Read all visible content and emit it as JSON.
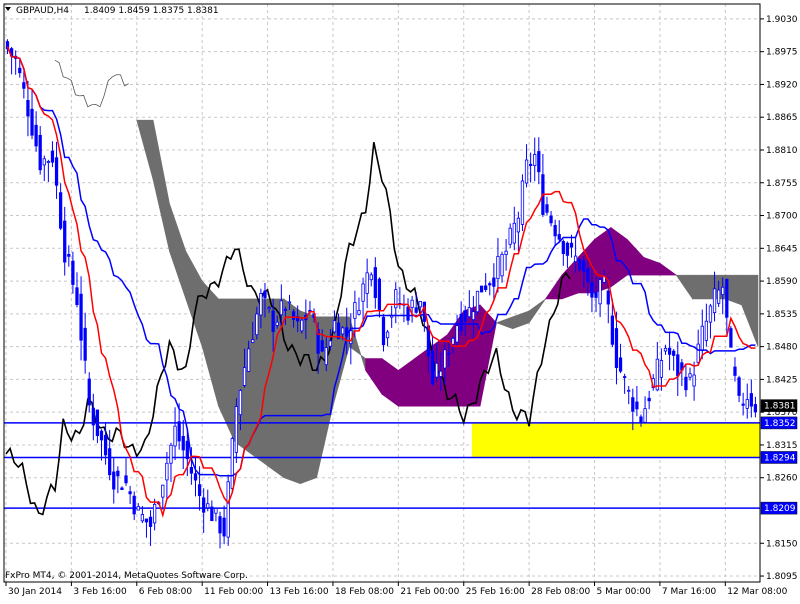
{
  "header": {
    "symbol_period": "GBPAUD,H4",
    "ohlc": "1.8409 1.8459 1.8375 1.8381"
  },
  "footer": {
    "copyright": "FxPro MT4, © 2001-2014, MetaQuotes Software Corp."
  },
  "colors": {
    "background": "#ffffff",
    "grid": "#c8c8c8",
    "candle": "#0000ff",
    "tenkan": "#ff0000",
    "kijun": "#0000ff",
    "chikou": "#000000",
    "cloud_up": "#6e6e6e",
    "cloud_down": "#800080",
    "zone": "#ffff00",
    "level": "#0000ff",
    "current_price_tag": "#000000"
  },
  "chart_data": {
    "type": "candlestick",
    "instrument": "GBPAUD",
    "timeframe": "H4",
    "ylim": [
      1.8085,
      1.9055
    ],
    "grid": true,
    "y_ticks": [
      "1.9030",
      "1.8975",
      "1.8920",
      "1.8865",
      "1.8810",
      "1.8755",
      "1.8700",
      "1.8645",
      "1.8590",
      "1.8535",
      "1.8480",
      "1.8425",
      "1.8370",
      "1.8315",
      "1.8260",
      "1.8150",
      "1.8095"
    ],
    "x_ticks": [
      "30 Jan 2014",
      "3 Feb 16:00",
      "6 Feb 08:00",
      "11 Feb 00:00",
      "13 Feb 16:00",
      "18 Feb 08:00",
      "21 Feb 00:00",
      "25 Feb 16:00",
      "28 Feb 08:00",
      "5 Mar 00:00",
      "7 Mar 16:00",
      "12 Mar 08:00"
    ],
    "x_tick_index": [
      0,
      16,
      32,
      48,
      64,
      80,
      96,
      112,
      128,
      144,
      160,
      176
    ],
    "bar_count": 184,
    "current_price": "1.8381",
    "support_levels": [
      "1.8352",
      "1.8294",
      "1.8209"
    ],
    "highlight_zone": {
      "from_index": 114,
      "to_index": 184,
      "top": 1.8352,
      "bottom": 1.8294
    },
    "close_anchors": [
      [
        0,
        1.899
      ],
      [
        3,
        1.896
      ],
      [
        6,
        1.888
      ],
      [
        9,
        1.879
      ],
      [
        12,
        1.88
      ],
      [
        15,
        1.864
      ],
      [
        18,
        1.856
      ],
      [
        21,
        1.838
      ],
      [
        24,
        1.832
      ],
      [
        27,
        1.826
      ],
      [
        30,
        1.825
      ],
      [
        33,
        1.82
      ],
      [
        36,
        1.818
      ],
      [
        39,
        1.826
      ],
      [
        42,
        1.834
      ],
      [
        45,
        1.829
      ],
      [
        48,
        1.823
      ],
      [
        51,
        1.82
      ],
      [
        54,
        1.817
      ],
      [
        57,
        1.838
      ],
      [
        60,
        1.848
      ],
      [
        63,
        1.856
      ],
      [
        66,
        1.852
      ],
      [
        69,
        1.855
      ],
      [
        72,
        1.851
      ],
      [
        75,
        1.854
      ],
      [
        78,
        1.846
      ],
      [
        81,
        1.852
      ],
      [
        84,
        1.85
      ],
      [
        87,
        1.856
      ],
      [
        90,
        1.862
      ],
      [
        93,
        1.85
      ],
      [
        96,
        1.856
      ],
      [
        99,
        1.854
      ],
      [
        102,
        1.856
      ],
      [
        105,
        1.842
      ],
      [
        108,
        1.846
      ],
      [
        111,
        1.852
      ],
      [
        114,
        1.854
      ],
      [
        117,
        1.858
      ],
      [
        120,
        1.86
      ],
      [
        123,
        1.864
      ],
      [
        126,
        1.87
      ],
      [
        128,
        1.878
      ],
      [
        130,
        1.88
      ],
      [
        132,
        1.872
      ],
      [
        135,
        1.868
      ],
      [
        138,
        1.864
      ],
      [
        141,
        1.862
      ],
      [
        144,
        1.856
      ],
      [
        147,
        1.858
      ],
      [
        150,
        1.846
      ],
      [
        153,
        1.84
      ],
      [
        156,
        1.836
      ],
      [
        159,
        1.842
      ],
      [
        162,
        1.848
      ],
      [
        165,
        1.844
      ],
      [
        168,
        1.842
      ],
      [
        171,
        1.85
      ],
      [
        174,
        1.856
      ],
      [
        176,
        1.858
      ],
      [
        178,
        1.846
      ],
      [
        180,
        1.838
      ],
      [
        182,
        1.84
      ],
      [
        184,
        1.8381
      ]
    ],
    "chikou_anchors": [
      [
        0,
        1.83
      ],
      [
        4,
        1.827
      ],
      [
        8,
        1.82
      ],
      [
        12,
        1.824
      ],
      [
        14,
        1.835
      ],
      [
        18,
        1.833
      ],
      [
        20,
        1.838
      ],
      [
        24,
        1.834
      ],
      [
        28,
        1.833
      ],
      [
        30,
        1.83
      ],
      [
        34,
        1.832
      ],
      [
        36,
        1.837
      ],
      [
        40,
        1.848
      ],
      [
        44,
        1.844
      ],
      [
        46,
        1.853
      ],
      [
        48,
        1.856
      ],
      [
        52,
        1.86
      ],
      [
        56,
        1.864
      ],
      [
        60,
        1.858
      ],
      [
        64,
        1.856
      ],
      [
        66,
        1.854
      ],
      [
        68,
        1.85
      ],
      [
        72,
        1.846
      ],
      [
        76,
        1.844
      ],
      [
        80,
        1.85
      ],
      [
        84,
        1.864
      ],
      [
        88,
        1.872
      ],
      [
        90,
        1.881
      ],
      [
        92,
        1.876
      ],
      [
        94,
        1.87
      ],
      [
        96,
        1.862
      ],
      [
        100,
        1.856
      ],
      [
        104,
        1.848
      ],
      [
        108,
        1.84
      ],
      [
        112,
        1.836
      ],
      [
        116,
        1.842
      ],
      [
        120,
        1.846
      ],
      [
        124,
        1.838
      ],
      [
        128,
        1.835
      ],
      [
        132,
        1.85
      ],
      [
        136,
        1.858
      ],
      [
        138,
        1.86
      ]
    ],
    "chikou_early_anchors": [
      [
        12,
        1.896
      ],
      [
        14,
        1.894
      ],
      [
        18,
        1.89
      ],
      [
        22,
        1.888
      ],
      [
        24,
        1.89
      ],
      [
        26,
        1.894
      ],
      [
        30,
        1.892
      ]
    ],
    "cloud_anchors": [
      [
        32,
        1.886,
        1.886
      ],
      [
        36,
        1.886,
        1.876
      ],
      [
        40,
        1.872,
        1.864
      ],
      [
        44,
        1.864,
        1.856
      ],
      [
        48,
        1.859,
        1.848
      ],
      [
        52,
        1.856,
        1.838
      ],
      [
        56,
        1.856,
        1.832
      ],
      [
        60,
        1.856,
        1.83
      ],
      [
        64,
        1.856,
        1.828
      ],
      [
        68,
        1.856,
        1.826
      ],
      [
        72,
        1.854,
        1.825
      ],
      [
        76,
        1.853,
        1.826
      ],
      [
        80,
        1.853,
        1.838
      ],
      [
        84,
        1.853,
        1.848
      ],
      [
        88,
        1.844,
        1.846
      ],
      [
        92,
        1.84,
        1.846
      ],
      [
        96,
        1.838,
        1.844
      ],
      [
        100,
        1.838,
        1.846
      ],
      [
        104,
        1.838,
        1.848
      ],
      [
        108,
        1.838,
        1.85
      ],
      [
        112,
        1.838,
        1.854
      ],
      [
        116,
        1.838,
        1.855
      ],
      [
        120,
        1.852,
        1.852
      ],
      [
        124,
        1.853,
        1.851
      ],
      [
        128,
        1.854,
        1.852
      ],
      [
        132,
        1.856,
        1.856
      ],
      [
        136,
        1.856,
        1.86
      ],
      [
        140,
        1.857,
        1.863
      ],
      [
        144,
        1.857,
        1.866
      ],
      [
        148,
        1.858,
        1.868
      ],
      [
        152,
        1.86,
        1.866
      ],
      [
        156,
        1.86,
        1.863
      ],
      [
        160,
        1.86,
        1.862
      ],
      [
        164,
        1.86,
        1.86
      ],
      [
        168,
        1.86,
        1.856
      ],
      [
        172,
        1.86,
        1.856
      ],
      [
        176,
        1.86,
        1.856
      ],
      [
        180,
        1.86,
        1.855
      ],
      [
        184,
        1.86,
        1.848
      ]
    ],
    "series": [
      {
        "name": "",
        "key": "candles"
      },
      {
        "name": "",
        "key": "tenkan"
      },
      {
        "name": "",
        "key": "kijun"
      },
      {
        "name": "",
        "key": "chikou"
      },
      {
        "name": "",
        "key": "cloud"
      }
    ]
  }
}
